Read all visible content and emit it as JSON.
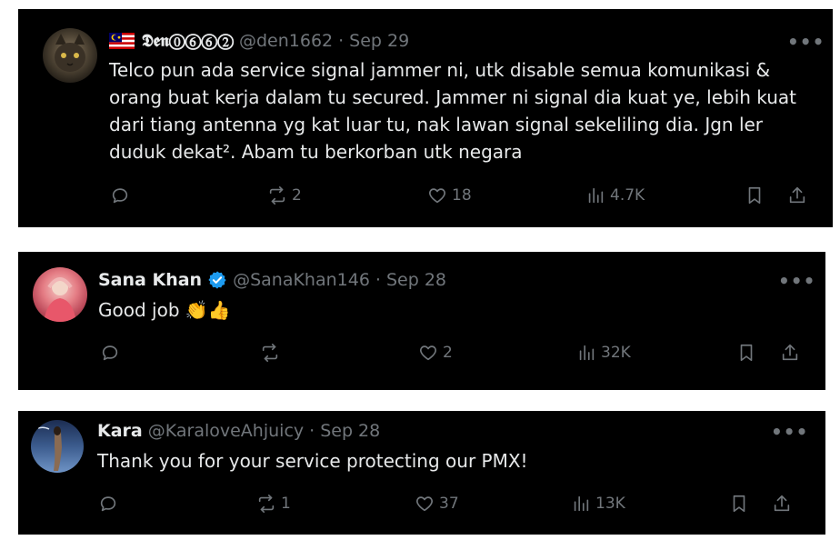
{
  "tweets": [
    {
      "flag_icon": "malaysia-flag-icon",
      "name": "𝕯𝖊𝖓⓪⑥⑥②",
      "handle": "@den1662",
      "separator": "·",
      "date": "Sep 29",
      "lines": [
        "Telco pun ada service signal jammer ni, utk disable semua komunikasi &",
        "orang buat kerja dalam tu secured. Jammer ni signal dia kuat ye, lebih kuat",
        "dari tiang antenna yg kat luar tu, nak lawan signal sekeliling dia. Jgn ler",
        "duduk dekat². Abam tu berkorban utk negara"
      ],
      "more": "•••",
      "reposts": "2",
      "likes": "18",
      "views": "4.7K"
    },
    {
      "name": "Sana Khan",
      "verified_color": "#1d9bf0",
      "handle": "@SanaKhan146",
      "separator": "·",
      "date": "Sep 28",
      "text": "Good job 👏👍",
      "more": "•••",
      "replies": "",
      "reposts": "",
      "likes": "2",
      "views": "32K"
    },
    {
      "name": "Kara",
      "handle": "@KaraloveAhjuicy",
      "separator": "·",
      "date": "Sep 28",
      "text": "Thank you for your service protecting our PMX!",
      "more": "•••",
      "reposts": "1",
      "likes": "37",
      "views": "13K"
    }
  ]
}
